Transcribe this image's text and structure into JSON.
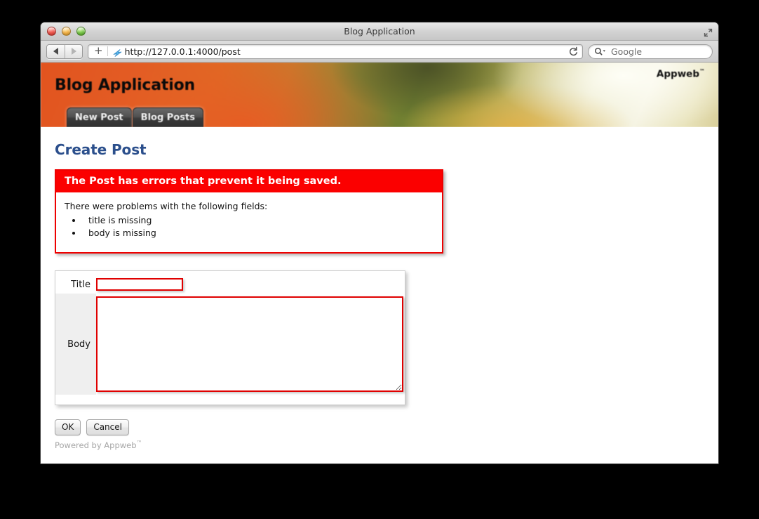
{
  "window": {
    "title": "Blog Application",
    "traffic_lights": [
      "close",
      "minimize",
      "zoom"
    ],
    "fullscreen_icon": "fullscreen-icon"
  },
  "toolbar": {
    "back_icon": "back-arrow-icon",
    "forward_icon": "forward-arrow-icon",
    "add_bookmark_label": "+",
    "favicon": "lightning-bolt-favicon",
    "url": "http://127.0.0.1:4000/post",
    "reload_icon": "reload-icon",
    "search_icon": "magnifier-icon",
    "search_placeholder": "Google",
    "search_value": ""
  },
  "app": {
    "title": "Blog Application",
    "brand": "Appweb",
    "brand_tm": "™",
    "tabs": [
      {
        "label": "New Post",
        "active": true
      },
      {
        "label": "Blog Posts",
        "active": false
      }
    ]
  },
  "main": {
    "heading": "Create Post",
    "error": {
      "title": "The Post has errors that prevent it being saved.",
      "intro": "There were problems with the following fields:",
      "items": [
        "title is missing",
        "body is missing"
      ]
    },
    "form": {
      "title_label": "Title",
      "title_value": "",
      "body_label": "Body",
      "body_value": ""
    },
    "buttons": {
      "ok": "OK",
      "cancel": "Cancel"
    }
  },
  "footer": {
    "text": "Powered by Appweb",
    "tm": "™"
  },
  "colors": {
    "error_red": "#fb0000",
    "field_border_red": "#e00000",
    "heading_blue": "#2b4f8c",
    "tab_dark": "#3b3b3b",
    "banner_orange": "#e2541f"
  }
}
